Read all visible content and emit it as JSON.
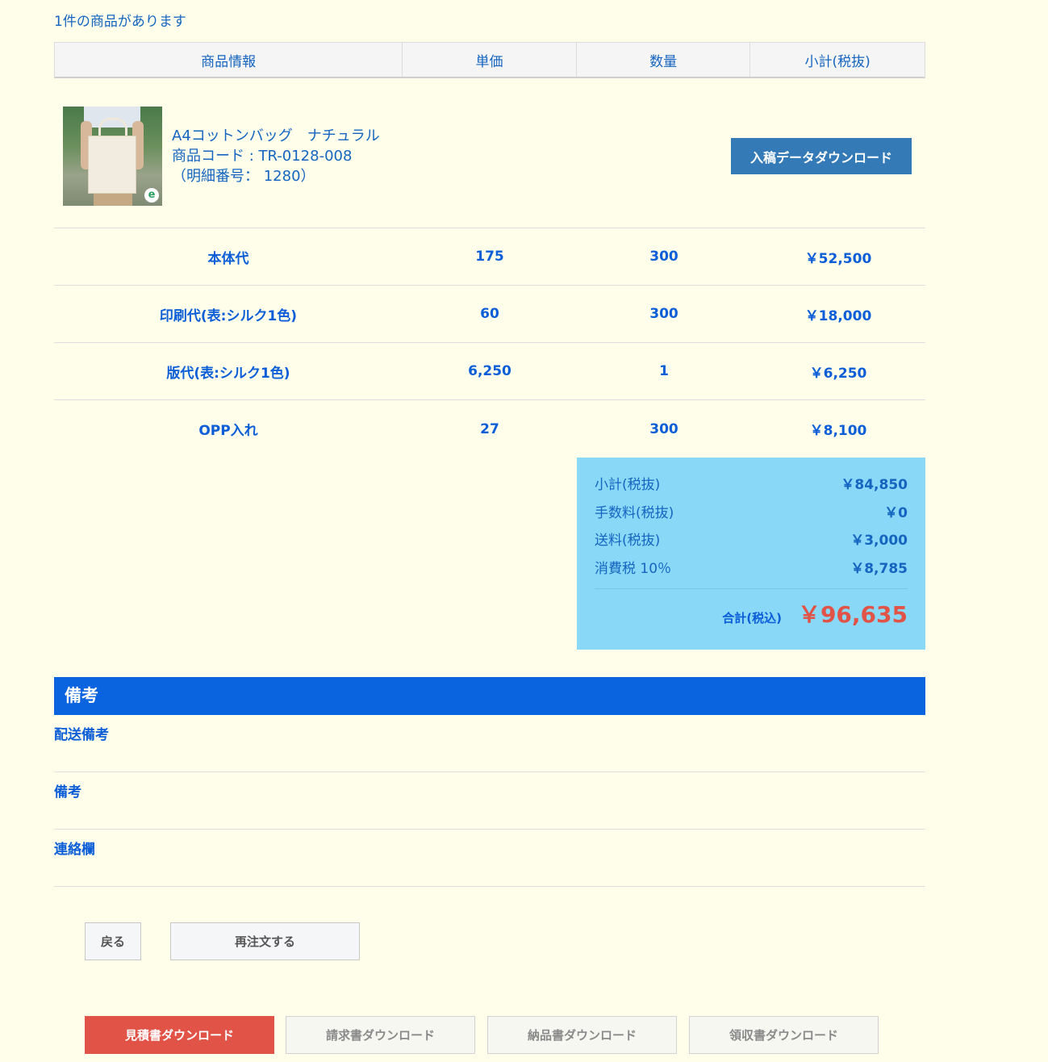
{
  "product_count": "1件の商品があります",
  "table_headers": [
    "商品情報",
    "単価",
    "数量",
    "小計(税抜)"
  ],
  "product": {
    "name": "A4コットンバッグ　ナチュラル",
    "code": "商品コード : TR-0128-008",
    "detail_no": "（明細番号： 1280）",
    "download_button": "入稿データダウンロード"
  },
  "detail_rows": [
    {
      "item": "本体代",
      "unit_price": "175",
      "qty": "300",
      "subtotal": "￥52,500"
    },
    {
      "item": "印刷代(表:シルク1色)",
      "unit_price": "60",
      "qty": "300",
      "subtotal": "￥18,000"
    },
    {
      "item": "版代(表:シルク1色)",
      "unit_price": "6,250",
      "qty": "1",
      "subtotal": "￥6,250"
    },
    {
      "item": "OPP入れ",
      "unit_price": "27",
      "qty": "300",
      "subtotal": "￥8,100"
    }
  ],
  "summary": {
    "rows": [
      {
        "label": "小計(税抜)",
        "value": "￥84,850"
      },
      {
        "label": "手数料(税抜)",
        "value": "￥0"
      },
      {
        "label": "送料(税抜)",
        "value": "￥3,000"
      },
      {
        "label": "消費税 10％",
        "value": "￥8,785"
      }
    ],
    "total_label": "合計(税込)",
    "total_value": "￥96,635"
  },
  "remarks": {
    "heading": "備考",
    "fields": [
      "配送備考",
      "備考",
      "連絡欄"
    ]
  },
  "actions": {
    "back": "戻る",
    "reorder": "再注文する"
  },
  "documents": {
    "estimate": "見積書ダウンロード",
    "invoice": "請求書ダウンロード",
    "delivery": "納品書ダウンロード",
    "receipt": "領収書ダウンロード"
  },
  "colors": {
    "background": "#fefeea",
    "accent_blue": "#0a63df",
    "summary_bg": "#89d8f8",
    "total_red": "#e05346",
    "download_btn": "#337ab7"
  }
}
